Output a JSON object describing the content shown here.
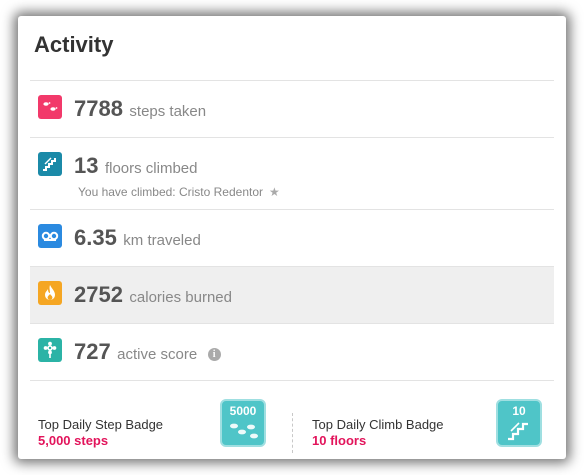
{
  "activity": {
    "title": "Activity",
    "stats": [
      {
        "value": "7788",
        "unit": "steps taken",
        "icon": "steps-icon",
        "color": "#f2396a"
      },
      {
        "value": "13",
        "unit": "floors climbed",
        "icon": "stairs-icon",
        "color": "#1b8aa8",
        "sub": "You have climbed: Cristo Redentor"
      },
      {
        "value": "6.35",
        "unit": "km traveled",
        "icon": "footprints-icon",
        "color": "#2b8ae0"
      },
      {
        "value": "2752",
        "unit": "calories burned",
        "icon": "flame-icon",
        "color": "#f5a623"
      },
      {
        "value": "727",
        "unit": "active score",
        "icon": "flower-icon",
        "color": "#2bb3a6"
      }
    ],
    "badges": [
      {
        "title": "Top Daily Step Badge",
        "value": "5,000 steps",
        "badge_label": "5000",
        "icon": "step-badge-icon"
      },
      {
        "title": "Top Daily Climb Badge",
        "value": "10 floors",
        "badge_label": "10",
        "icon": "climb-badge-icon"
      }
    ],
    "highlight_color": "#e2145b",
    "badge_color": "#4fc5c8"
  }
}
